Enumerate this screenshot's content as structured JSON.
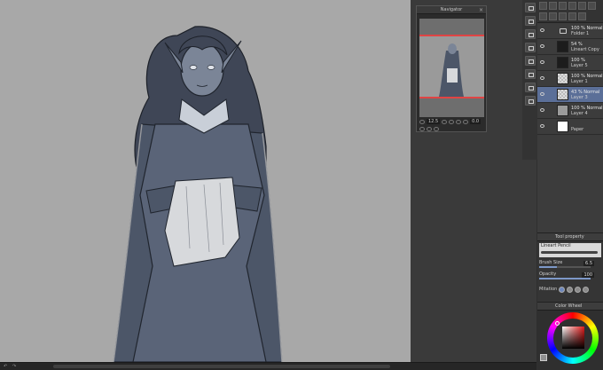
{
  "navigator": {
    "title": "Navigator",
    "zoom_value": "12.5",
    "rotation_value": "0.0"
  },
  "layers": [
    {
      "mode": "100 % Normal",
      "name": "Folder 1",
      "kind": "folder",
      "selected": false
    },
    {
      "mode": "54 %",
      "name": "Lineart Copy",
      "kind": "dark",
      "selected": false
    },
    {
      "mode": "100 %",
      "name": "Layer 5",
      "kind": "dark",
      "selected": false
    },
    {
      "mode": "100 % Normal",
      "name": "Layer 1",
      "kind": "check",
      "selected": false
    },
    {
      "mode": "43 % Normal",
      "name": "Layer 3",
      "kind": "check",
      "selected": true
    },
    {
      "mode": "100 % Normal",
      "name": "Layer 4",
      "kind": "grey",
      "selected": false
    },
    {
      "mode": "",
      "name": "Paper",
      "kind": "white",
      "selected": false
    }
  ],
  "tool_property": {
    "header": "Tool property",
    "brush_name": "Lineart Pencil",
    "brush_size_label": "Brush Size",
    "brush_size_value": "6.5",
    "opacity_label": "Opacity",
    "opacity_value": "100",
    "mode_label": "Mitation"
  },
  "color_wheel": {
    "header": "Color Wheel"
  },
  "colors": {
    "selected_layer": "#5b6f98",
    "canvas_bg": "#a8a8a8",
    "current_color": "#e21a1a"
  }
}
